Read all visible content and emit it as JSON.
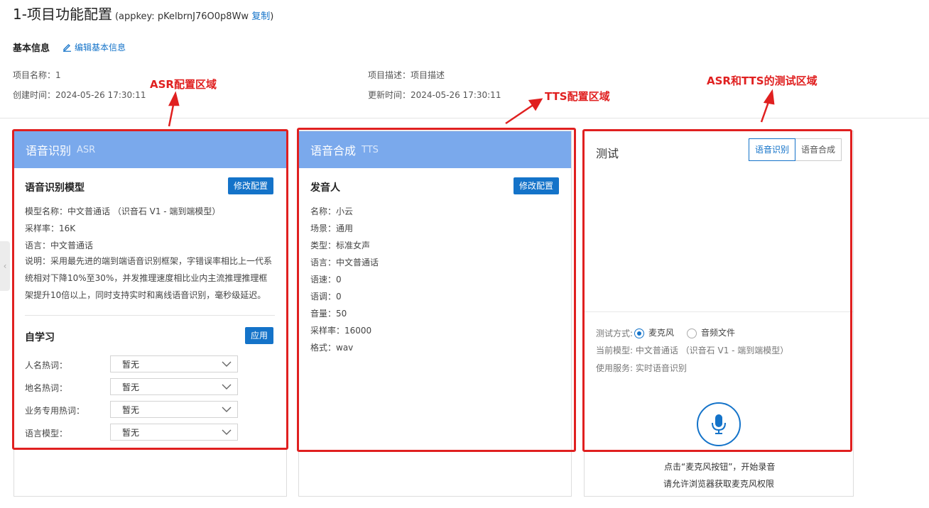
{
  "header": {
    "title": "1-项目功能配置",
    "appkey_text": "(appkey: pKelbrnJ76O0p8Ww",
    "copy_label": "复制",
    "appkey_close": ")"
  },
  "basic_info": {
    "label": "基本信息",
    "edit_label": "编辑基本信息",
    "name": "项目名称：1",
    "created": "创建时间：2024-05-26 17:30:11",
    "description": "项目描述：项目描述",
    "updated": "更新时间：2024-05-26 17:30:11"
  },
  "asr_panel": {
    "title": "语音识别",
    "sub": "ASR",
    "model_section": "语音识别模型",
    "modify_label": "修改配置",
    "model_name": "模型名称：中文普通话 （识音石 V1 - 端到端模型）",
    "sample_rate": "采样率：16K",
    "language": "语言：中文普通话",
    "description": "说明：采用最先进的端到端语音识别框架，字错误率相比上一代系统相对下降10%至30%，并发推理速度相比业内主流推理推理框架提升10倍以上，同时支持实时和离线语音识别，毫秒级延迟。",
    "self_learning": "自学习",
    "apply_label": "应用",
    "hotwords": [
      {
        "label": "人名热词：",
        "value": "暂无"
      },
      {
        "label": "地名热词：",
        "value": "暂无"
      },
      {
        "label": "业务专用热词：",
        "value": "暂无"
      },
      {
        "label": "语言模型：",
        "value": "暂无"
      }
    ]
  },
  "tts_panel": {
    "title": "语音合成",
    "sub": "TTS",
    "speaker_section": "发音人",
    "modify_label": "修改配置",
    "fields": [
      "名称：小云",
      "场景：通用",
      "类型：标准女声",
      "语言：中文普通话",
      "语速：0",
      "语调：0",
      "音量：50",
      "采样率：16000",
      "格式：wav"
    ]
  },
  "test_panel": {
    "title": "测试",
    "tab_asr": "语音识别",
    "tab_tts": "语音合成",
    "method_label": "测试方式:",
    "option_mic": "麦克风",
    "option_file": "音频文件",
    "current_model": "当前模型: 中文普通话 （识音石 V1 - 端到端模型）",
    "service": "使用服务: 实时语音识别",
    "hint1": "点击“麦克风按钮”，开始录音",
    "hint2": "请允许浏览器获取麦克风权限",
    "mic_icon": "microphone-icon"
  },
  "annotations": {
    "asr": "ASR配置区域",
    "tts": "TTS配置区域",
    "test": "ASR和TTS的测试区域",
    "color": "#e02020"
  },
  "colors": {
    "accent": "#1473c9",
    "panel_header": "#7aa9ec"
  }
}
